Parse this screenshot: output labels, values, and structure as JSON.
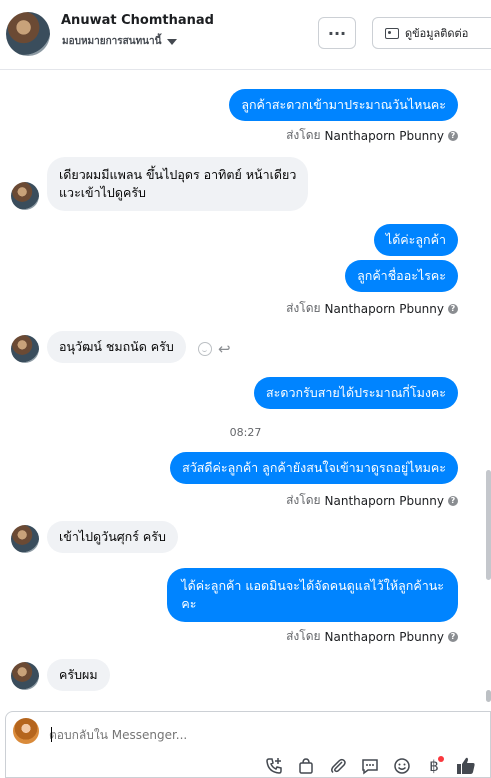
{
  "header": {
    "contact_name": "Anuwat Chomthanad",
    "assign_label": "มอบหมายการสนทนานี้",
    "more_label": "···",
    "view_contact_label": "ดูข้อมูลติดต่อ"
  },
  "messages": [
    {
      "dir": "out",
      "text": "ลูกค้าสะดวกเข้ามาประมาณวันไหนคะ"
    },
    {
      "dir": "sent_by",
      "prefix": "ส่งโดย",
      "agent": "Nanthaporn Pbunny"
    },
    {
      "dir": "in",
      "lines": [
        "เดียวผมมีแพลน ขึ้นไปอุดร อาทิตย์ หน้าเดียว",
        "แวะเข้าไปดูครับ"
      ]
    },
    {
      "dir": "out",
      "text": "ได้ค่ะลูกค้า"
    },
    {
      "dir": "out",
      "text": "ลูกค้าชื่ออะไรคะ"
    },
    {
      "dir": "sent_by",
      "prefix": "ส่งโดย",
      "agent": "Nanthaporn Pbunny"
    },
    {
      "dir": "in",
      "text": "อนุวัฒน์ ชมถนัด ครับ"
    },
    {
      "dir": "out",
      "text": "สะดวกรับสายได้ประมาณกี่โมงคะ"
    },
    {
      "dir": "time",
      "text": "08:27"
    },
    {
      "dir": "out",
      "text": "สวัสดีค่ะลูกค้า ลูกค้ายังสนใจเข้ามาดูรถอยู่ไหมคะ"
    },
    {
      "dir": "sent_by",
      "prefix": "ส่งโดย",
      "agent": "Nanthaporn Pbunny"
    },
    {
      "dir": "in",
      "text": "เข้าไปดูวันศุกร์ ครับ"
    },
    {
      "dir": "out",
      "lines": [
        "ได้ค่ะลูกค้า แอดมินจะได้จัดคนดูแลไว้ให้ลูกค้านะ",
        "คะ"
      ]
    },
    {
      "dir": "sent_by",
      "prefix": "ส่งโดย",
      "agent": "Nanthaporn Pbunny"
    },
    {
      "dir": "in",
      "text": "ครับผม"
    }
  ],
  "composer": {
    "placeholder": "ตอบกลับใน Messenger..."
  },
  "icons": {
    "help": "?",
    "reply": "↩",
    "like": "👍",
    "baht": "฿"
  },
  "colors": {
    "outgoing_bubble": "#0084ff",
    "incoming_bubble": "#f0f2f5"
  }
}
